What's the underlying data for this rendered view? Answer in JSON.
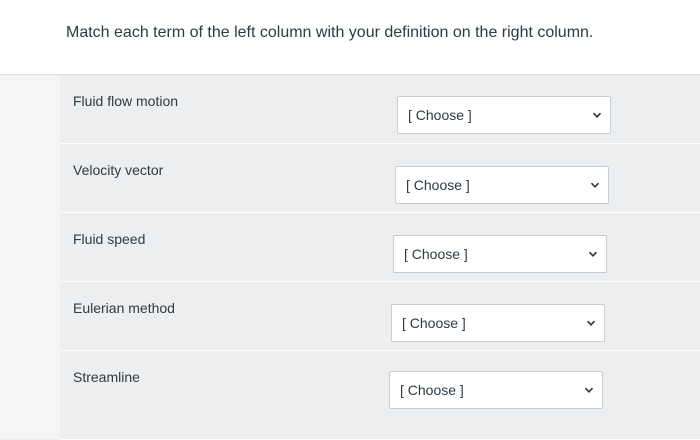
{
  "question": {
    "text": "Match each term of the left column with your definition on the right column."
  },
  "rows": [
    {
      "term": "Fluid flow motion",
      "select": {
        "value": "[ Choose ]",
        "icon": "chevron-down-icon"
      }
    },
    {
      "term": "Velocity vector",
      "select": {
        "value": "[ Choose ]",
        "icon": "chevron-down-icon"
      }
    },
    {
      "term": "Fluid speed",
      "select": {
        "value": "[ Choose ]",
        "icon": "chevron-down-icon"
      }
    },
    {
      "term": "Eulerian method",
      "select": {
        "value": "[ Choose ]",
        "icon": "chevron-down-icon"
      }
    },
    {
      "term": "Streamline",
      "select": {
        "value": "[ Choose ]",
        "icon": "chevron-down-icon"
      }
    }
  ],
  "colors": {
    "text": "#2d3b45",
    "row_background": "#eceeef",
    "select_border": "#c7cdd1"
  }
}
